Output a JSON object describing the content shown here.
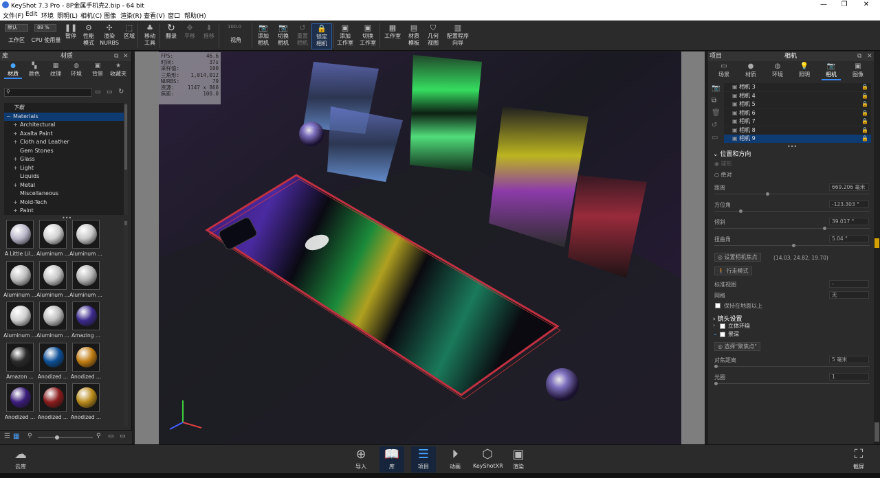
{
  "window": {
    "title": "KeyShot 7.3 Pro - 8P金属手机壳2.bip - 64 bit",
    "minimize": "—",
    "maximize": "❐",
    "close": "✕"
  },
  "menu": [
    "文件(F)",
    "Edit",
    "环境",
    "照明(L)",
    "相机(C)",
    "图像",
    "渲染(R)",
    "查看(V)",
    "窗口",
    "帮助(H)"
  ],
  "toolbar": {
    "workspace_value": "默认",
    "workspace_label": "工作区",
    "cpu_value": "88 %",
    "cpu_label": "CPU 使用量",
    "pause": "暂停",
    "perf_mode": "性能\n模式",
    "render_nurbs": "渲染\nNURBS",
    "region": "区域",
    "move_tool": "移动\n工具",
    "refresh": "翻录",
    "pan": "平移",
    "dolly": "推移",
    "fov_value": "100.0",
    "fov_label": "视角",
    "add_camera": "添加\n相机",
    "switch_camera": "切换\n相机",
    "reset_camera": "重置\n相机",
    "lock_camera": "锁定\n相机",
    "add_studio": "添加\n工作室",
    "switch_studio": "切换\n工作室",
    "studio": "工作室",
    "material_template": "材质\n模板",
    "geometry_view": "几何\n视图",
    "config_wizard": "配置程序\n向导"
  },
  "library": {
    "header": "库",
    "panel_title": "材质",
    "tabs": [
      "材质",
      "颜色",
      "纹理",
      "环境",
      "背景",
      "收藏夹"
    ],
    "tree": [
      {
        "label": "下载",
        "indent": 0,
        "prefix": ""
      },
      {
        "label": "Materials",
        "indent": 0,
        "prefix": "−",
        "selected": true
      },
      {
        "label": "Architectural",
        "indent": 1,
        "prefix": "+"
      },
      {
        "label": "Axalta Paint",
        "indent": 1,
        "prefix": "+"
      },
      {
        "label": "Cloth and Leather",
        "indent": 1,
        "prefix": "+"
      },
      {
        "label": "Gem Stones",
        "indent": 1,
        "prefix": ""
      },
      {
        "label": "Glass",
        "indent": 1,
        "prefix": "+"
      },
      {
        "label": "Light",
        "indent": 1,
        "prefix": "+"
      },
      {
        "label": "Liquids",
        "indent": 1,
        "prefix": ""
      },
      {
        "label": "Metal",
        "indent": 1,
        "prefix": "+"
      },
      {
        "label": "Miscellaneous",
        "indent": 1,
        "prefix": ""
      },
      {
        "label": "Mold-Tech",
        "indent": 1,
        "prefix": "+"
      },
      {
        "label": "Paint",
        "indent": 1,
        "prefix": "+"
      }
    ],
    "thumbnails": [
      {
        "label": "A Little Lil...",
        "color": "#b9b6c9"
      },
      {
        "label": "Aluminum ...",
        "color": "#d0d0d0"
      },
      {
        "label": "Aluminum ...",
        "color": "#c8c8c8"
      },
      {
        "label": "Aluminum ...",
        "color": "#bdbdbd"
      },
      {
        "label": "Aluminum ...",
        "color": "#c4c4c4"
      },
      {
        "label": "Aluminum ...",
        "color": "#b5b5b5"
      },
      {
        "label": "Aluminum ...",
        "color": "#cfcfcf"
      },
      {
        "label": "Aluminum ...",
        "color": "#bcbcbc"
      },
      {
        "label": "Amazing ...",
        "color": "#3b2a8c"
      },
      {
        "label": "Amazon ...",
        "color": "#2a2a2a"
      },
      {
        "label": "Anodized ...",
        "color": "#0c4f96"
      },
      {
        "label": "Anodized ...",
        "color": "#c07c12"
      },
      {
        "label": "Anodized ...",
        "color": "#3b1c7a"
      },
      {
        "label": "Anodized ...",
        "color": "#8a1c1c"
      },
      {
        "label": "Anodized ...",
        "color": "#b88a1a"
      }
    ]
  },
  "stats": [
    {
      "k": "FPS:",
      "v": "46.6"
    },
    {
      "k": "时间:",
      "v": "37s"
    },
    {
      "k": "采样值:",
      "v": "100"
    },
    {
      "k": "三角形:",
      "v": "1,014,012"
    },
    {
      "k": "NURBS:",
      "v": "79"
    },
    {
      "k": "资源:",
      "v": "1147 x 860"
    },
    {
      "k": "焦距:",
      "v": "100.0"
    }
  ],
  "project": {
    "header": "项目",
    "panel_title": "相机",
    "tabs": [
      "场景",
      "材质",
      "环境",
      "照明",
      "相机",
      "图像"
    ],
    "cameras": [
      "相机 3",
      "相机 4",
      "相机 5",
      "相机 6",
      "相机 7",
      "相机 8",
      "相机 9"
    ],
    "selected_camera": "相机 9",
    "position_section": "位置和方向",
    "radio_orbit": "球形",
    "radio_absolute": "绝对",
    "distance_label": "距离",
    "distance_value": "669.206 毫米",
    "azimuth_label": "方位角",
    "azimuth_value": "-123.303 °",
    "inclination_label": "倾斜",
    "inclination_value": "39.017 °",
    "twist_label": "扭曲角",
    "twist_value": "5.04 °",
    "set_focus_btn": "设置相机焦点",
    "focus_coords": "(14.03, 24.82, 19.70)",
    "walk_mode_btn": "行走模式",
    "standard_view_label": "标准视图",
    "standard_view_value": "-",
    "grid_label": "网格",
    "grid_value": "无",
    "stay_above_ground": "保持在地面以上",
    "lens_section": "镜头设置",
    "stereo": "立体环绕",
    "dof": "景深",
    "select_focus_btn": "选择\"聚焦点\"",
    "focus_distance_label": "对焦距离",
    "focus_distance_value": "5 毫米",
    "aperture_label": "光圈",
    "aperture_value": "1"
  },
  "bottom": {
    "cloud": "云库",
    "import": "导入",
    "library": "库",
    "project": "项目",
    "animation": "动画",
    "keyshotxr": "KeyShotXR",
    "render": "渲染",
    "screenshot": "截屏"
  },
  "colors": {
    "accent": "#3a8bff",
    "selection": "#0f3b73",
    "panel": "#2b2b2b"
  }
}
